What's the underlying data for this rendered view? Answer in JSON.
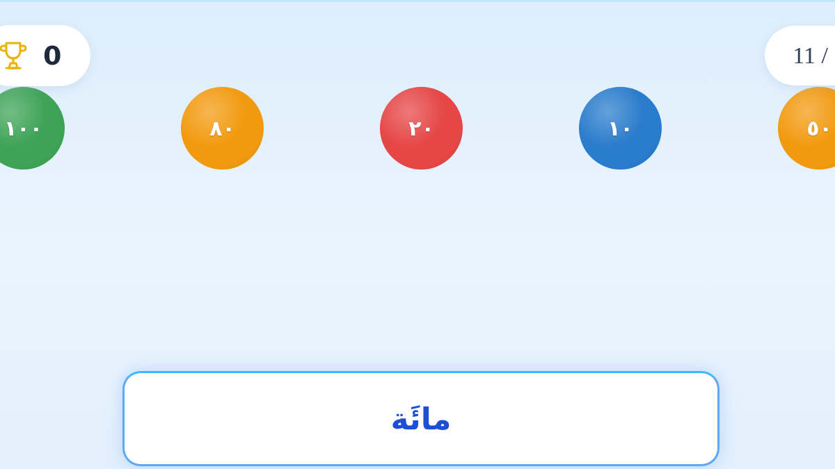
{
  "score": {
    "value": "0"
  },
  "progress": {
    "text": "11 /"
  },
  "balls": [
    {
      "label": "٥٠",
      "color": "#f29a0f"
    },
    {
      "label": "١٠",
      "color": "#2a7ccc"
    },
    {
      "label": "٢٠",
      "color": "#e64646"
    },
    {
      "label": "٨٠",
      "color": "#f29a0f"
    },
    {
      "label": "١٠٠",
      "color": "#3ea356"
    }
  ],
  "answer": {
    "text": "مائَة"
  }
}
